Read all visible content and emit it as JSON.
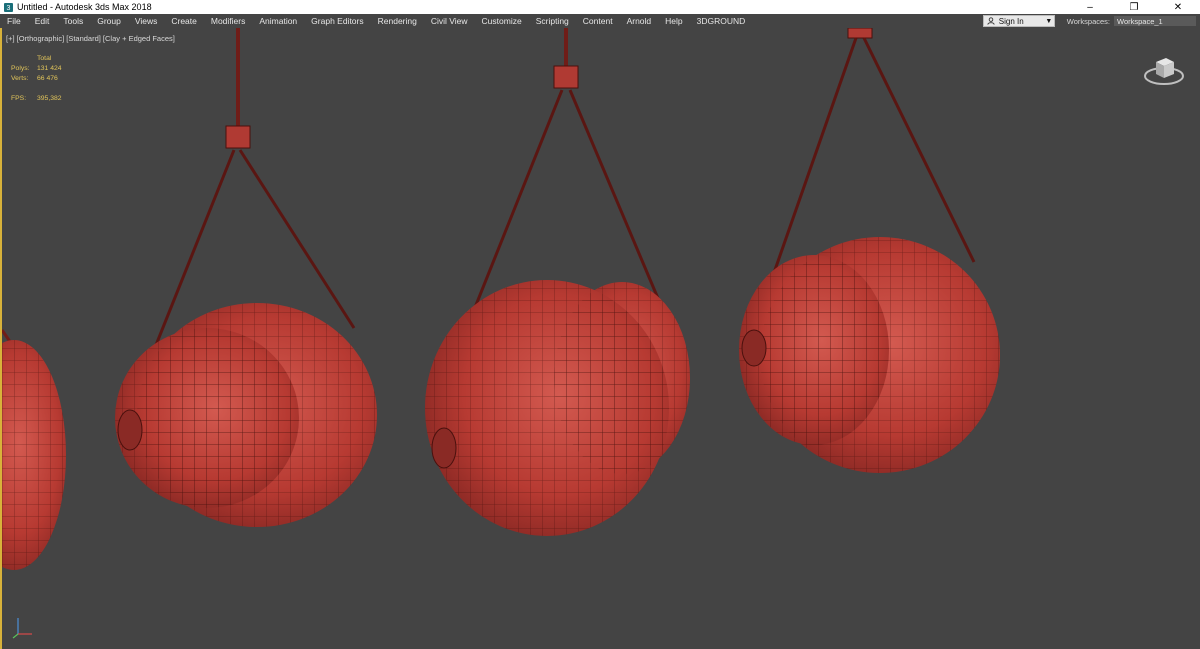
{
  "window": {
    "title": "Untitled - Autodesk 3ds Max 2018",
    "buttons": [
      "–",
      "❐",
      "✕"
    ]
  },
  "menu": {
    "items": [
      "File",
      "Edit",
      "Tools",
      "Group",
      "Views",
      "Create",
      "Modifiers",
      "Animation",
      "Graph Editors",
      "Rendering",
      "Civil View",
      "Customize",
      "Scripting",
      "Content",
      "Arnold",
      "Help",
      "3DGROUND"
    ],
    "sign_in": "Sign In",
    "workspaces_label": "Workspaces:",
    "workspace_value": "Workspace_1"
  },
  "viewport": {
    "label": "[+] [Orthographic] [Standard] [Clay + Edged Faces]",
    "stats": {
      "total": "Total",
      "polys_label": "Polys:",
      "polys": "131 424",
      "verts_label": "Verts:",
      "verts": "66 476",
      "fps_label": "FPS:",
      "fps": "395,382"
    }
  },
  "colors": {
    "viewport_bg": "#444444",
    "object": "#b73a32",
    "stats_text": "#e2c55a",
    "active_border": "#d8b23a"
  }
}
